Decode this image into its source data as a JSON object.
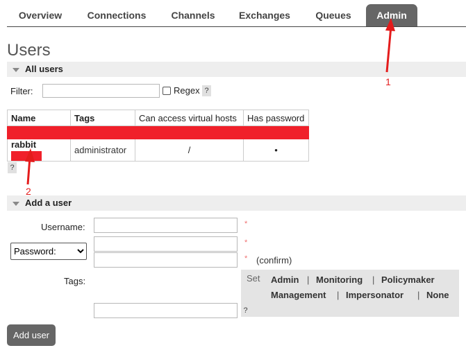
{
  "nav": {
    "tabs": [
      {
        "label": "Overview"
      },
      {
        "label": "Connections"
      },
      {
        "label": "Channels"
      },
      {
        "label": "Exchanges"
      },
      {
        "label": "Queues"
      },
      {
        "label": "Admin",
        "active": true
      }
    ]
  },
  "page": {
    "title": "Users"
  },
  "all_users": {
    "heading": "All users",
    "filter_label": "Filter:",
    "filter_value": "",
    "regex_label": "Regex",
    "help": "?",
    "columns": [
      "Name",
      "Tags",
      "Can access virtual hosts",
      "Has password"
    ],
    "rows": [
      {
        "name": "rabbit",
        "tags": "administrator",
        "vhosts": "/",
        "has_password": "•"
      }
    ]
  },
  "add_user": {
    "heading": "Add a user",
    "username_label": "Username:",
    "password_option": "Password:",
    "required_mark": "*",
    "confirm_label": "(confirm)",
    "tags_label": "Tags:",
    "set_label": "Set",
    "tag_options": [
      "Admin",
      "Monitoring",
      "Policymaker",
      "Management",
      "Impersonator",
      "None"
    ],
    "separator": "|",
    "help": "?",
    "submit_label": "Add user"
  },
  "annotations": {
    "one": "1",
    "two": "2"
  },
  "colors": {
    "accent": "#666666",
    "redaction": "#f0202a",
    "annotation": "#e41c1c"
  }
}
